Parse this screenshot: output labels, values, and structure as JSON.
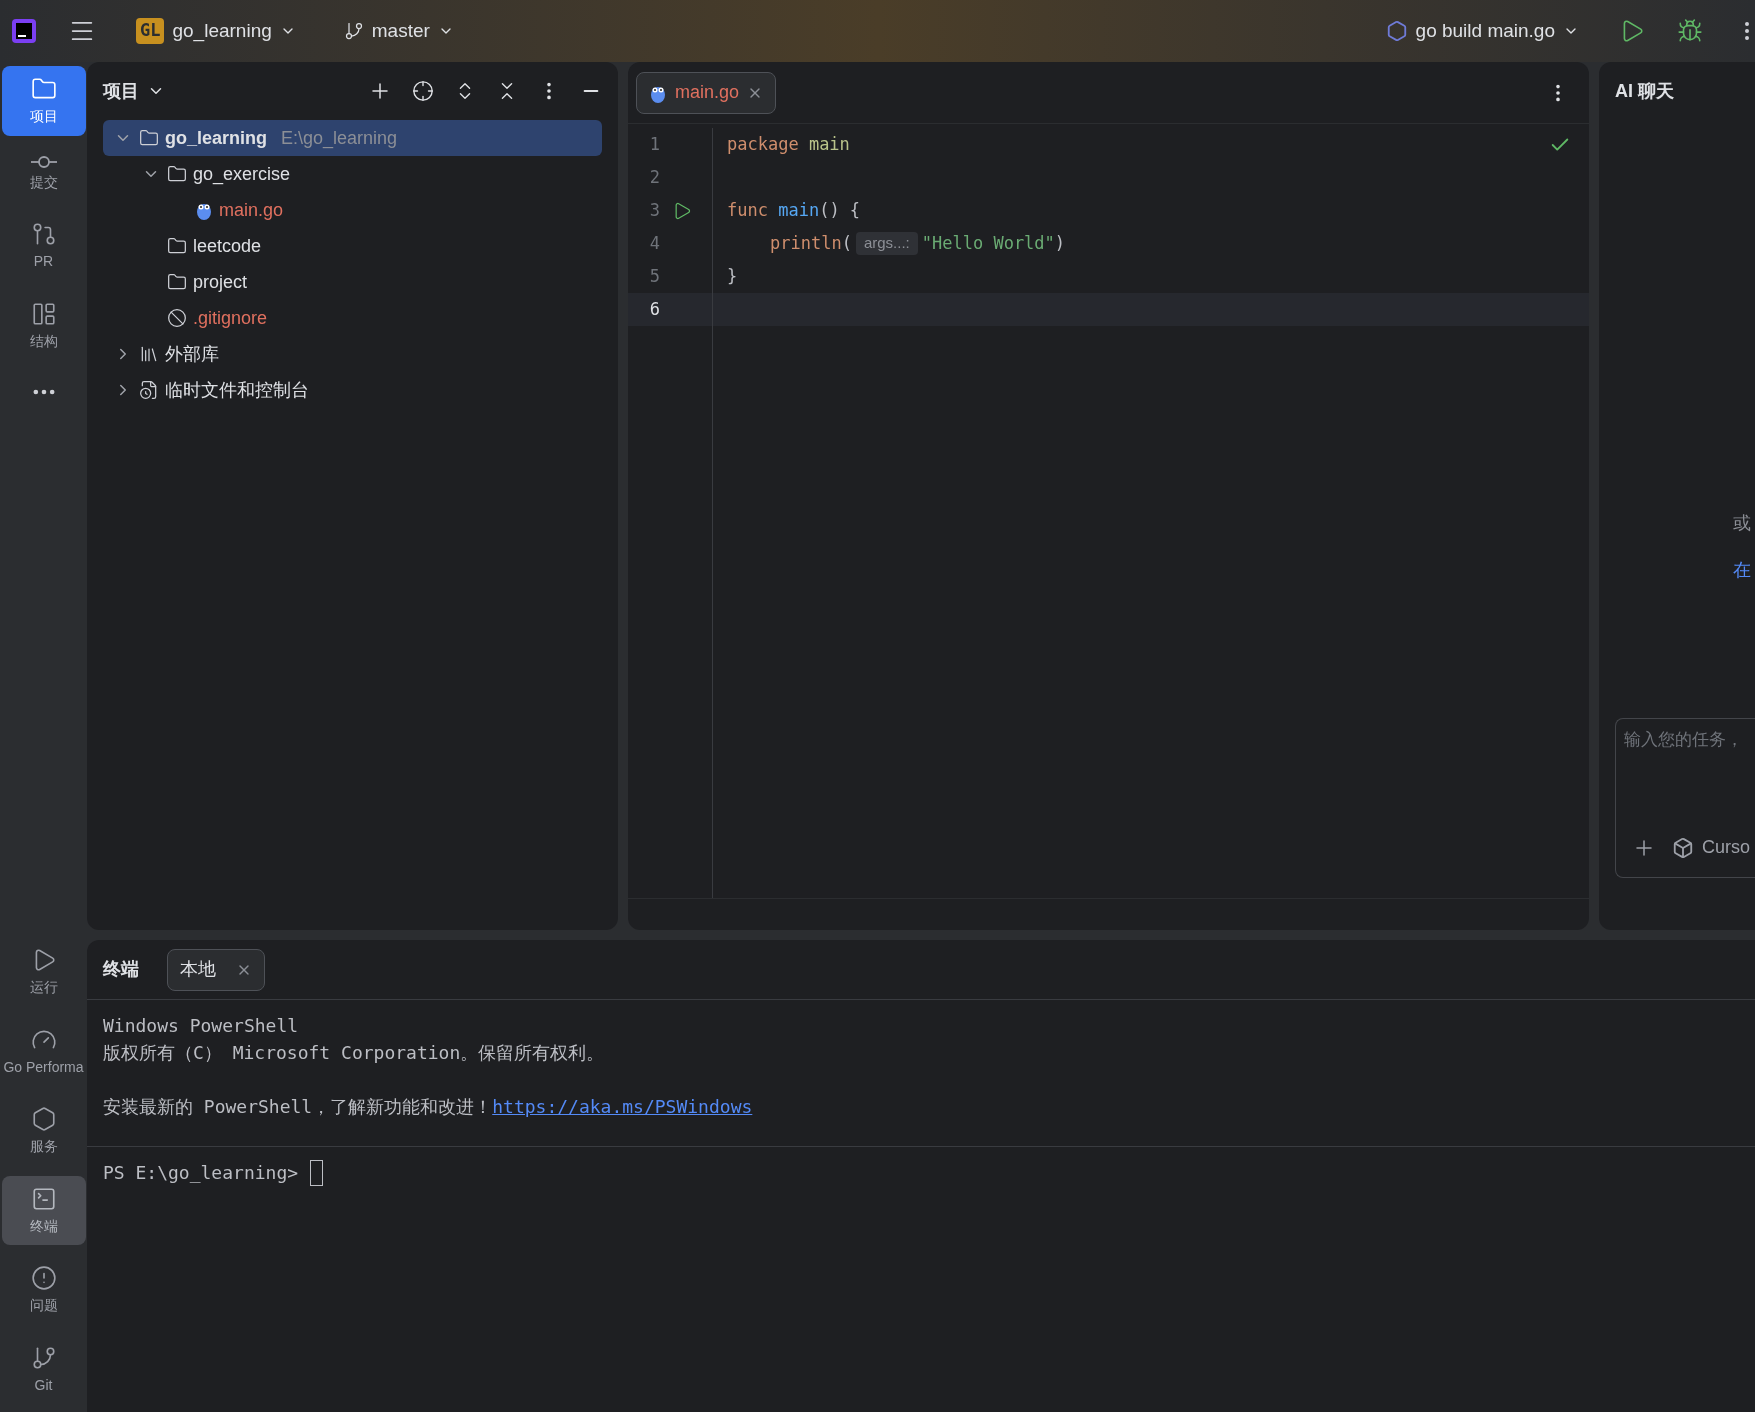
{
  "title_bar": {
    "project_badge": "GL",
    "project": "go_learning",
    "branch": "master",
    "run_config": "go build main.go"
  },
  "tool_strip": {
    "top": [
      {
        "label": "项目",
        "selected": true
      },
      {
        "label": "提交",
        "selected": false
      },
      {
        "label": "PR",
        "selected": false
      },
      {
        "label": "结构",
        "selected": false
      }
    ],
    "bottom": [
      {
        "label": "运行",
        "selected": false
      },
      {
        "label": "Go Performa",
        "selected": false
      },
      {
        "label": "服务",
        "selected": false
      },
      {
        "label": "终端",
        "selected": true
      },
      {
        "label": "问题",
        "selected": false
      },
      {
        "label": "Git",
        "selected": false
      }
    ]
  },
  "project_panel": {
    "title": "项目",
    "tree": [
      {
        "kind": "root",
        "name": "go_learning",
        "path": "E:\\go_learning",
        "selected": true,
        "expanded": true,
        "children": [
          {
            "kind": "folder",
            "name": "go_exercise",
            "selected": false,
            "expanded": true,
            "children": [
              {
                "kind": "gofile",
                "name": "main.go",
                "selected": false
              }
            ]
          },
          {
            "kind": "folder",
            "name": "leetcode",
            "selected": false
          },
          {
            "kind": "folder",
            "name": "project",
            "selected": false
          },
          {
            "kind": "ignored",
            "name": ".gitignore",
            "selected": false
          }
        ]
      },
      {
        "kind": "library",
        "name": "外部库",
        "selected": false,
        "expanded": false
      },
      {
        "kind": "scratch",
        "name": "临时文件和控制台",
        "selected": false,
        "expanded": false
      }
    ]
  },
  "editor": {
    "tabs": [
      {
        "label": "main.go",
        "selected": true
      }
    ],
    "lines": [
      {
        "number": "1",
        "run": false,
        "current": false,
        "tokens": [
          {
            "kind": "keyword",
            "text": "package "
          },
          {
            "kind": "name",
            "text": "main"
          }
        ]
      },
      {
        "number": "2",
        "run": false,
        "current": false
      },
      {
        "number": "3",
        "run": true,
        "current": false,
        "tokens": [
          {
            "kind": "keyword",
            "text": "func "
          },
          {
            "kind": "function",
            "text": "main"
          },
          {
            "kind": "plain",
            "text": "() {"
          }
        ]
      },
      {
        "number": "4",
        "run": false,
        "current": false,
        "indent": true,
        "tokens": [
          {
            "kind": "builtin",
            "text": "println"
          },
          {
            "kind": "plain",
            "text": "("
          },
          {
            "kind": "hint",
            "text": "args...:"
          },
          {
            "kind": "string",
            "text": "\"Hello World\""
          },
          {
            "kind": "plain",
            "text": ")"
          }
        ]
      },
      {
        "number": "5",
        "run": false,
        "current": false,
        "tokens": [
          {
            "kind": "plain",
            "text": "}"
          }
        ]
      },
      {
        "number": "6",
        "run": false,
        "current": true
      }
    ]
  },
  "ai_panel": {
    "title": "AI 聊天",
    "fragments": [
      {
        "kind": "plain",
        "text": "或"
      },
      {
        "kind": "link",
        "text": "在"
      }
    ],
    "input_placeholder": "输入您的任务，",
    "model": "Curso"
  },
  "terminal": {
    "title": "终端",
    "tabs": [
      {
        "label": "本地",
        "selected": true
      }
    ],
    "output": [
      [
        {
          "text": "Windows PowerShell"
        },
        {
          "text": "版权所有（C） Microsoft Corporation。保留所有权利。"
        }
      ],
      [
        {
          "text": "安装最新的 PowerShell，了解新功能和改进！",
          "link": "https://aka.ms/PSWindows"
        }
      ]
    ],
    "prompt": "PS E:\\go_learning>"
  }
}
